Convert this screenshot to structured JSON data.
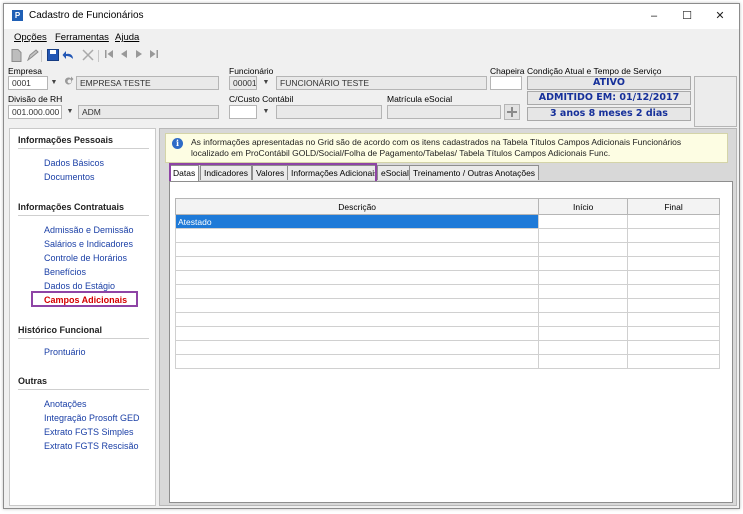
{
  "window": {
    "title": "Cadastro de Funcionários",
    "icon_letter": "P",
    "controls": {
      "minimize": "–",
      "maximize": "☐",
      "close": "✕"
    }
  },
  "menu": {
    "items": [
      "Opções",
      "Ferramentas",
      "Ajuda"
    ]
  },
  "toolbar": {
    "icons": [
      "new-icon",
      "edit-icon",
      "save-icon",
      "undo-icon",
      "delete-icon",
      "first-icon",
      "prev-icon",
      "next-icon",
      "last-icon"
    ]
  },
  "header": {
    "empresa_label": "Empresa",
    "empresa_code": "0001",
    "empresa_name": "EMPRESA TESTE",
    "funcionario_label": "Funcionário",
    "funcionario_code": "00001",
    "funcionario_name": "FUNCIONÁRIO TESTE",
    "chapeira_label": "Chapeira",
    "chapeira_value": "",
    "divisao_label": "Divisão de RH",
    "divisao_code": "001.000.000",
    "divisao_name": "ADM",
    "custo_label": "C/Custo Contábil",
    "custo_value": "",
    "matricula_label": "Matrícula eSocial",
    "matricula_value": "",
    "condicao_label": "Condição Atual e Tempo de Serviço",
    "status": "ATIVO",
    "admitido": "ADMITIDO EM: 01/12/2017",
    "tempo": "3 anos 8 meses 2 dias"
  },
  "nav": {
    "sections": [
      {
        "title": "Informações Pessoais",
        "items": [
          "Dados Básicos",
          "Documentos"
        ]
      },
      {
        "title": "Informações Contratuais",
        "items": [
          "Admissão e Demissão",
          "Salários e Indicadores",
          "Controle de Horários",
          "Benefícios",
          "Dados do Estágio",
          "Campos Adicionais"
        ]
      },
      {
        "title": "Histórico Funcional",
        "items": [
          "Prontuário"
        ]
      },
      {
        "title": "Outras",
        "items": [
          "Anotações",
          "Integração Prosoft GED",
          "Extrato FGTS Simples",
          "Extrato FGTS Rescisão"
        ]
      }
    ],
    "active_item": "Campos Adicionais"
  },
  "info": {
    "text": "As informações apresentadas no Grid são de acordo com os itens cadastrados na Tabela Títulos Campos Adicionais Funcionários localizado em ProContábil GOLD/Social/Folha de Pagamento/Tabelas/ Tabela Títulos Campos Adicionais Func."
  },
  "tabs": [
    "Datas",
    "Indicadores",
    "Valores",
    "Informações Adicionais",
    "eSocial",
    "Treinamento / Outras Anotações"
  ],
  "active_tab": "Datas",
  "grid": {
    "columns": [
      "Descrição",
      "Início",
      "Final"
    ],
    "rows": [
      [
        "Atestado",
        "",
        ""
      ],
      [
        "",
        "",
        ""
      ],
      [
        "",
        "",
        ""
      ],
      [
        "",
        "",
        ""
      ],
      [
        "",
        "",
        ""
      ],
      [
        "",
        "",
        ""
      ],
      [
        "",
        "",
        ""
      ],
      [
        "",
        "",
        ""
      ],
      [
        "",
        "",
        ""
      ],
      [
        "",
        "",
        ""
      ],
      [
        "",
        "",
        ""
      ]
    ],
    "selected_row": 0
  },
  "colors": {
    "accent": "#1e7ad8",
    "status_text": "#16309a",
    "active_nav": "#d40000",
    "highlight": "#8e44a5"
  }
}
